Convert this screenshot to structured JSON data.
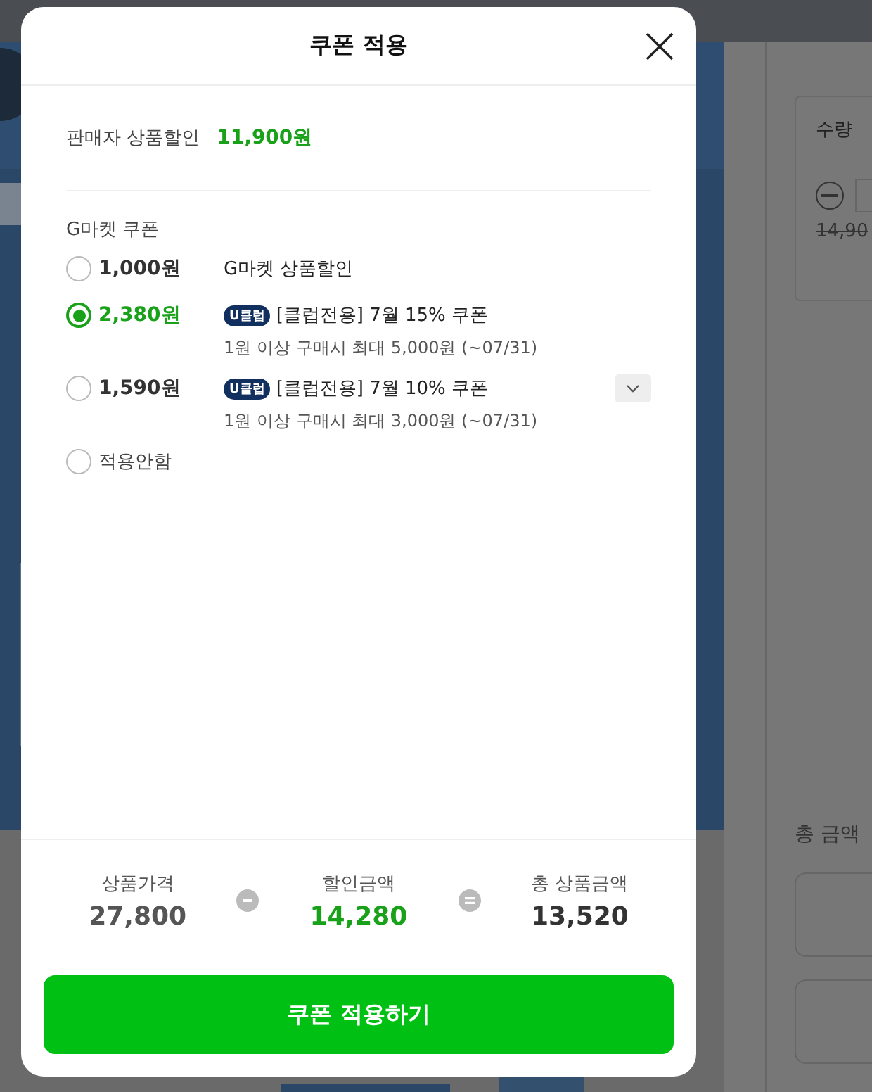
{
  "background_page": {
    "quantity_label": "수량",
    "original_price": "14,90",
    "total_label": "총 금액"
  },
  "dialog": {
    "title": "쿠폰 적용",
    "seller_discount": {
      "label": "판매자 상품할인",
      "value": "11,900원"
    },
    "coupon_section": {
      "title": "G마켓 쿠폰",
      "coupons": [
        {
          "amount": "1,000원",
          "title": "G마켓 상품할인",
          "selected": false
        },
        {
          "amount": "2,380원",
          "badge": "U클럽",
          "title": "[클럽전용] 7월 15% 쿠폰",
          "detail": "1원 이상 구매시 최대 5,000원 (~07/31)",
          "selected": true
        },
        {
          "amount": "1,590원",
          "badge": "U클럽",
          "title": "[클럽전용] 7월 10% 쿠폰",
          "detail": "1원 이상 구매시 최대 3,000원 (~07/31)",
          "selected": false,
          "expanded": false
        },
        {
          "label": "적용안함",
          "selected": false
        }
      ]
    },
    "summary": [
      {
        "label": "상품가격",
        "value": "27,800",
        "kind": "price"
      },
      {
        "kind": "minus"
      },
      {
        "label": "할인금액",
        "value": "14,280",
        "kind": "discount"
      },
      {
        "kind": "equals"
      },
      {
        "label": "총 상품금액",
        "value": "13,520",
        "kind": "total"
      }
    ],
    "apply_button": "쿠폰 적용하기"
  }
}
